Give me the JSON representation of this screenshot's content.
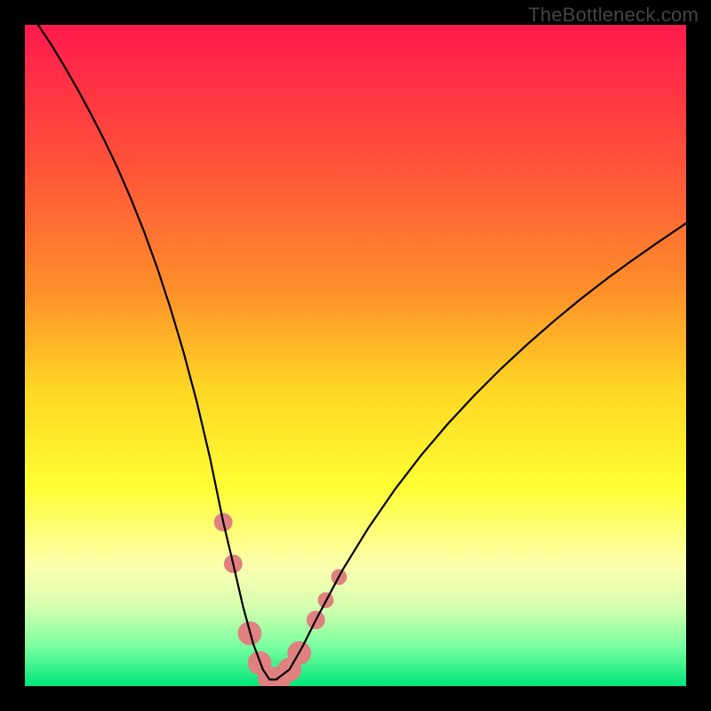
{
  "watermark": "TheBottleneck.com",
  "chart_data": {
    "type": "line",
    "title": "",
    "xlabel": "",
    "ylabel": "",
    "xlim": [
      0,
      100
    ],
    "ylim": [
      0,
      100
    ],
    "grid": false,
    "legend": false,
    "background_gradient": {
      "stops": [
        {
          "offset": 0.0,
          "color": "#ff1a4d"
        },
        {
          "offset": 0.2,
          "color": "#ff4f3a"
        },
        {
          "offset": 0.4,
          "color": "#ff8f2a"
        },
        {
          "offset": 0.55,
          "color": "#ffd624"
        },
        {
          "offset": 0.7,
          "color": "#ffff33"
        },
        {
          "offset": 0.82,
          "color": "#fdffb0"
        },
        {
          "offset": 0.88,
          "color": "#d6ffb0"
        },
        {
          "offset": 0.94,
          "color": "#7affa0"
        },
        {
          "offset": 1.0,
          "color": "#00e57a"
        }
      ]
    },
    "series": [
      {
        "name": "bottleneck-curve",
        "color": "#000000",
        "x": [
          2,
          4,
          6,
          8,
          10,
          12,
          14,
          16,
          18,
          20,
          22,
          24,
          26,
          28,
          30,
          31.5,
          33,
          34.5,
          36,
          37,
          38,
          40,
          42,
          44,
          48,
          52,
          56,
          60,
          64,
          68,
          72,
          76,
          80,
          84,
          88,
          92,
          96,
          100
        ],
        "values": [
          100,
          97,
          93.7,
          90.2,
          86.5,
          82.6,
          78.4,
          73.8,
          68.8,
          63.3,
          57.2,
          50.5,
          43.0,
          34.5,
          24.8,
          18.5,
          12.0,
          6.5,
          2.5,
          1.0,
          1.0,
          2.5,
          6.0,
          10.0,
          17.5,
          24.0,
          29.8,
          35.0,
          39.7,
          44.0,
          48.0,
          51.7,
          55.2,
          58.5,
          61.6,
          64.5,
          67.3,
          70.0
        ]
      }
    ],
    "markers": {
      "name": "trough-beads",
      "color": "#e08080",
      "points": [
        {
          "x": 30.0,
          "y": 24.8,
          "r": 1.4
        },
        {
          "x": 31.5,
          "y": 18.5,
          "r": 1.4
        },
        {
          "x": 34.0,
          "y": 8.0,
          "r": 1.8
        },
        {
          "x": 35.5,
          "y": 3.5,
          "r": 1.8
        },
        {
          "x": 37.0,
          "y": 1.2,
          "r": 1.8
        },
        {
          "x": 38.5,
          "y": 1.2,
          "r": 1.8
        },
        {
          "x": 40.0,
          "y": 2.5,
          "r": 1.8
        },
        {
          "x": 41.5,
          "y": 5.0,
          "r": 1.8
        },
        {
          "x": 44.0,
          "y": 10.0,
          "r": 1.4
        },
        {
          "x": 45.5,
          "y": 13.0,
          "r": 1.2
        },
        {
          "x": 47.5,
          "y": 16.5,
          "r": 1.2
        }
      ]
    }
  }
}
